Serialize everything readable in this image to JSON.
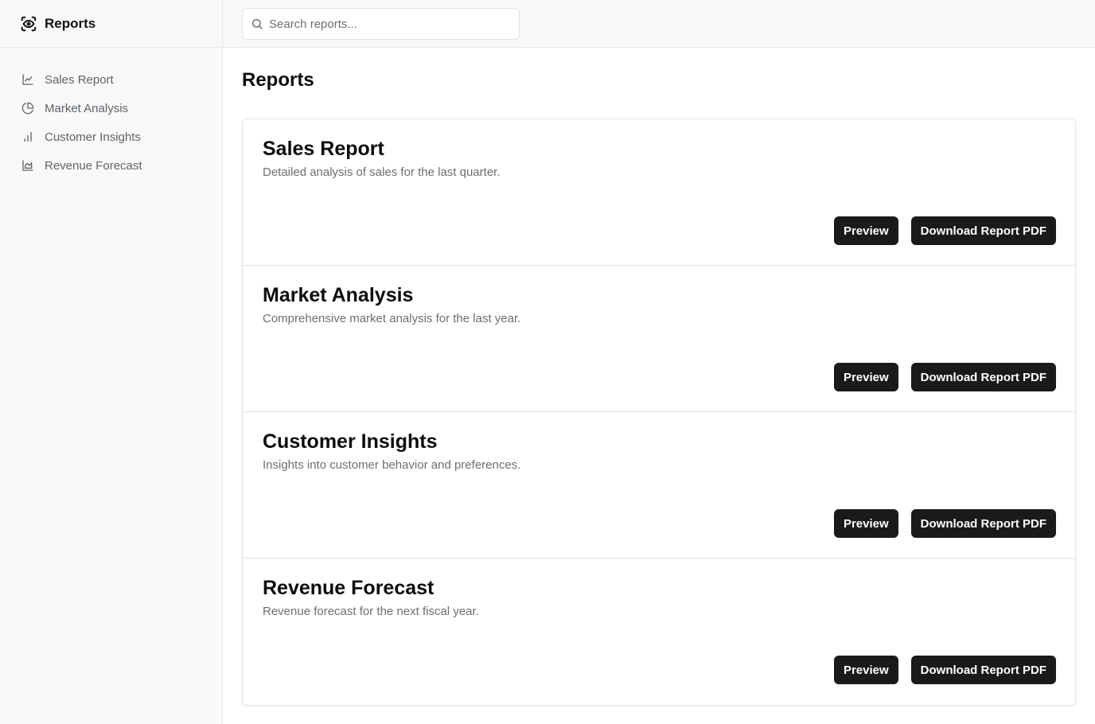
{
  "app": {
    "title": "Reports",
    "logo_icon": "eye-scan-icon"
  },
  "search": {
    "placeholder": "Search reports...",
    "value": ""
  },
  "sidebar": {
    "items": [
      {
        "label": "Sales Report",
        "icon": "line-chart-icon"
      },
      {
        "label": "Market Analysis",
        "icon": "pie-chart-icon"
      },
      {
        "label": "Customer Insights",
        "icon": "bar-chart-icon"
      },
      {
        "label": "Revenue Forecast",
        "icon": "area-chart-icon"
      }
    ]
  },
  "main": {
    "title": "Reports",
    "reports": [
      {
        "title": "Sales Report",
        "description": "Detailed analysis of sales for the last quarter.",
        "preview_label": "Preview",
        "download_label": "Download Report PDF"
      },
      {
        "title": "Market Analysis",
        "description": "Comprehensive market analysis for the last year.",
        "preview_label": "Preview",
        "download_label": "Download Report PDF"
      },
      {
        "title": "Customer Insights",
        "description": "Insights into customer behavior and preferences.",
        "preview_label": "Preview",
        "download_label": "Download Report PDF"
      },
      {
        "title": "Revenue Forecast",
        "description": "Revenue forecast for the next fiscal year.",
        "preview_label": "Preview",
        "download_label": "Download Report PDF"
      }
    ]
  },
  "colors": {
    "button_bg": "#1a1a1b",
    "sidebar_bg": "#f8f9f9",
    "muted_text": "#6b6f73"
  }
}
